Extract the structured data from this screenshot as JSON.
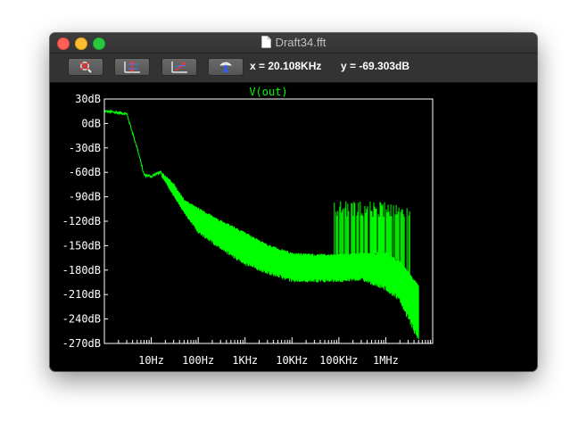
{
  "window": {
    "title": "Draft34.fft"
  },
  "toolbar": {
    "buttons": [
      {
        "name": "zoom-cancel-button",
        "icon": "magnifier-cancel-icon"
      },
      {
        "name": "autorange-y-button",
        "icon": "autorange-vertical-icon"
      },
      {
        "name": "autorange-xy-button",
        "icon": "autorange-diagonal-icon"
      },
      {
        "name": "copy-to-clipboard-button",
        "icon": "paste-hand-icon"
      }
    ],
    "cursor_x": "x = 20.108KHz",
    "cursor_y": "y = -69.303dB"
  },
  "chart_data": {
    "type": "line",
    "title": "V(out)",
    "series": [
      {
        "name": "V(out)",
        "color": "#00ff00"
      }
    ],
    "x_scale": "log",
    "xlim": [
      1,
      10000000
    ],
    "ylim": [
      -270,
      30
    ],
    "x_ticks": [
      "10Hz",
      "100Hz",
      "1KHz",
      "10KHz",
      "100KHz",
      "1MHz"
    ],
    "y_ticks": [
      "30dB",
      "0dB",
      "-30dB",
      "-60dB",
      "-90dB",
      "-120dB",
      "-150dB",
      "-180dB",
      "-210dB",
      "-240dB",
      "-270dB"
    ],
    "envelope": {
      "upper": [
        [
          1,
          15
        ],
        [
          3,
          12
        ],
        [
          5,
          -30
        ],
        [
          7,
          -63
        ],
        [
          10,
          -65
        ],
        [
          15,
          -60
        ],
        [
          20,
          -65
        ],
        [
          30,
          -75
        ],
        [
          50,
          -95
        ],
        [
          100,
          -105
        ],
        [
          300,
          -120
        ],
        [
          1000,
          -135
        ],
        [
          3000,
          -150
        ],
        [
          10000,
          -160
        ],
        [
          30000,
          -162
        ],
        [
          100000,
          -162
        ],
        [
          300000,
          -160
        ],
        [
          1000000,
          -160
        ],
        [
          2000000,
          -170
        ],
        [
          5000000,
          -200
        ]
      ],
      "lower": [
        [
          1,
          15
        ],
        [
          3,
          12
        ],
        [
          5,
          -30
        ],
        [
          7,
          -63
        ],
        [
          10,
          -65
        ],
        [
          15,
          -62
        ],
        [
          20,
          -72
        ],
        [
          30,
          -90
        ],
        [
          50,
          -110
        ],
        [
          100,
          -135
        ],
        [
          300,
          -155
        ],
        [
          1000,
          -175
        ],
        [
          3000,
          -185
        ],
        [
          10000,
          -195
        ],
        [
          30000,
          -195
        ],
        [
          100000,
          -195
        ],
        [
          300000,
          -193
        ],
        [
          1000000,
          -205
        ],
        [
          2000000,
          -220
        ],
        [
          5000000,
          -270
        ]
      ]
    },
    "spurs_db": -115,
    "grid": false,
    "background": "#000000",
    "axis_color": "#ffffff"
  }
}
